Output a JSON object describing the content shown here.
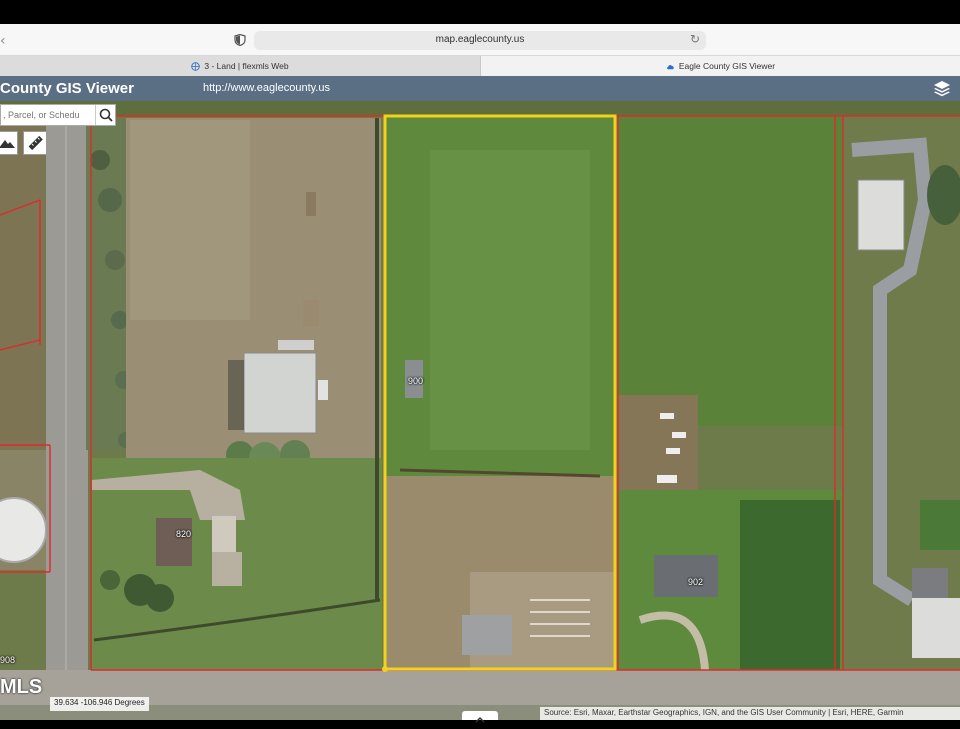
{
  "browser": {
    "url": "map.eaglecounty.us",
    "tabs": [
      {
        "label": "3 - Land | flexmls Web"
      },
      {
        "label": "Eagle County GIS Viewer"
      }
    ]
  },
  "app": {
    "title": "County GIS Viewer",
    "url": "http://www.eaglecounty.us"
  },
  "search": {
    "placeholder": ", Parcel, or Schedu"
  },
  "map": {
    "parcel_labels": [
      "900",
      "820",
      "902",
      "908"
    ],
    "selection_color": "#f2d21a",
    "boundary_color": "#e02a2a"
  },
  "footer": {
    "coordinates": "39.634 -106.946 Degrees",
    "attribution": "Source: Esri, Maxar, Earthstar Geographics, IGN, and the GIS User Community | Esri, HERE, Garmin",
    "watermark": "MLS"
  }
}
